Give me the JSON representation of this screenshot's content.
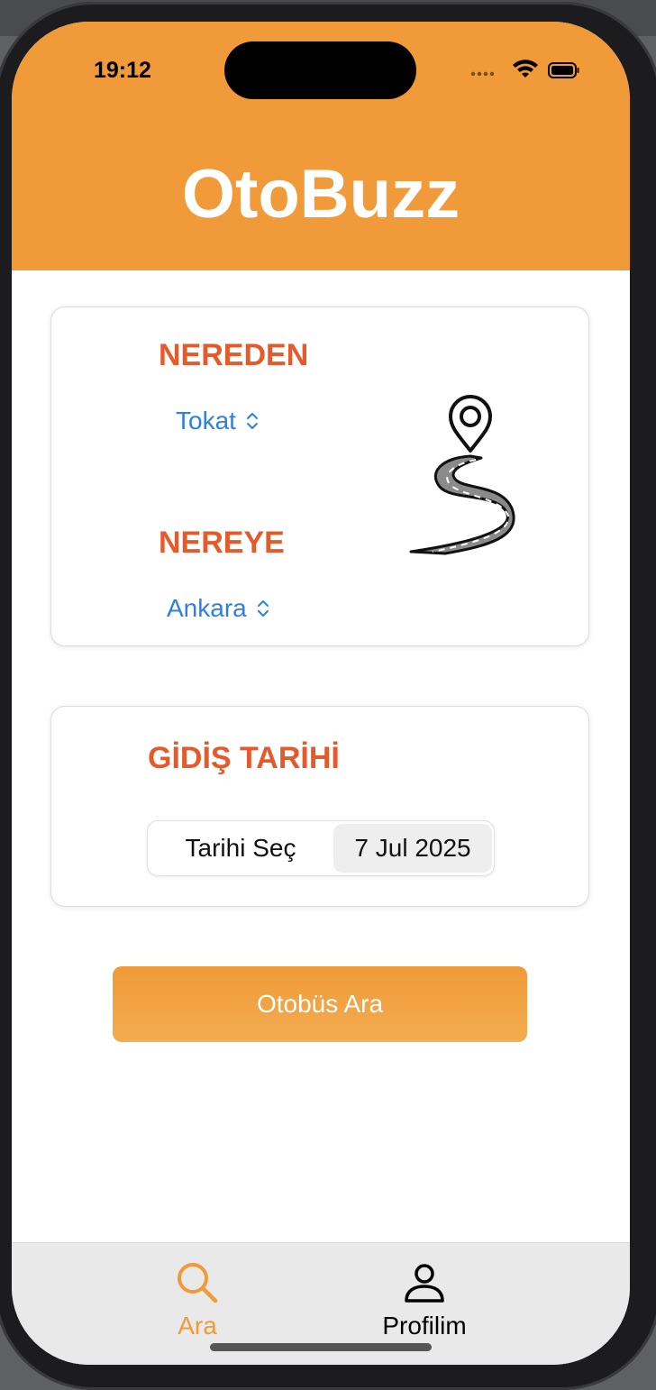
{
  "status_bar": {
    "time": "19:12"
  },
  "header": {
    "title": "OtoBuzz"
  },
  "route_card": {
    "from_label": "NEREDEN",
    "from_value": "Tokat",
    "to_label": "NEREYE",
    "to_value": "Ankara"
  },
  "date_card": {
    "label": "GİDİŞ TARİHİ",
    "picker_label": "Tarihi Seç",
    "picker_value": "7 Jul 2025"
  },
  "search_button": {
    "label": "Otobüs Ara"
  },
  "tabs": [
    {
      "label": "Ara",
      "icon": "search-icon",
      "active": true
    },
    {
      "label": "Profilim",
      "icon": "person-icon",
      "active": false
    }
  ],
  "colors": {
    "brand_orange": "#f19a3a",
    "label_red": "#e55a2b",
    "link_blue": "#2d7fe8"
  }
}
